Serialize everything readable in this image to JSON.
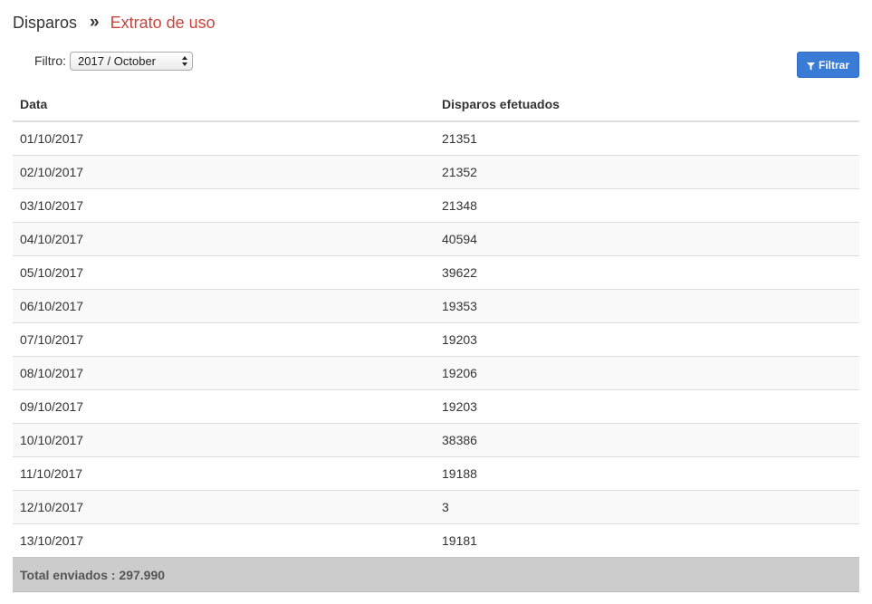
{
  "breadcrumb": {
    "root": "Disparos",
    "separator": "»",
    "current": "Extrato de uso"
  },
  "filter": {
    "label": "Filtro:",
    "selected": "2017 / October",
    "button_label": "Filtrar",
    "button_icon": "funnel-icon"
  },
  "table": {
    "columns": [
      "Data",
      "Disparos efetuados"
    ],
    "rows": [
      {
        "date": "01/10/2017",
        "count": "21351"
      },
      {
        "date": "02/10/2017",
        "count": "21352"
      },
      {
        "date": "03/10/2017",
        "count": "21348"
      },
      {
        "date": "04/10/2017",
        "count": "40594"
      },
      {
        "date": "05/10/2017",
        "count": "39622"
      },
      {
        "date": "06/10/2017",
        "count": "19353"
      },
      {
        "date": "07/10/2017",
        "count": "19203"
      },
      {
        "date": "08/10/2017",
        "count": "19206"
      },
      {
        "date": "09/10/2017",
        "count": "19203"
      },
      {
        "date": "10/10/2017",
        "count": "38386"
      },
      {
        "date": "11/10/2017",
        "count": "19188"
      },
      {
        "date": "12/10/2017",
        "count": "3"
      },
      {
        "date": "13/10/2017",
        "count": "19181"
      }
    ],
    "total_label": "Total enviados : 297.990"
  },
  "colors": {
    "accent": "#c9443b",
    "button": "#3a7bd5",
    "footer": "#cccccc"
  }
}
